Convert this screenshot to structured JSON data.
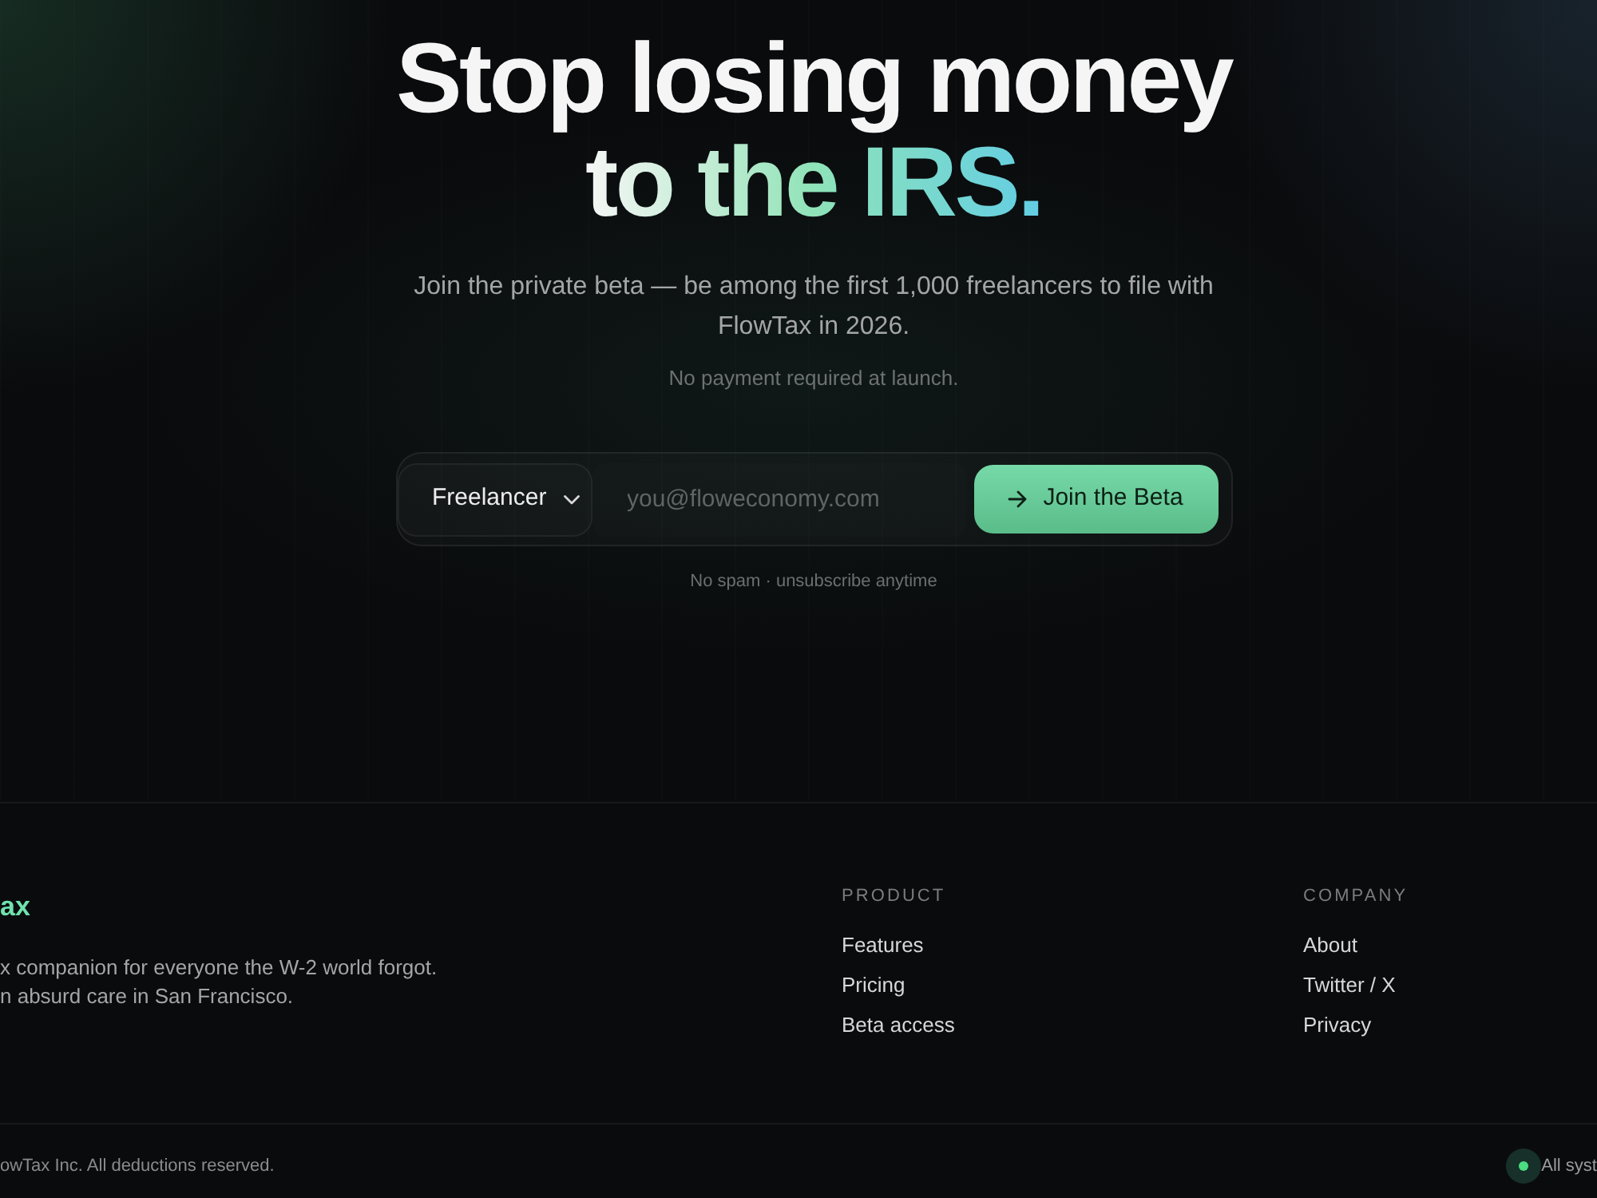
{
  "hero": {
    "headline": {
      "text": "Stop losing money",
      "highlight": "to the IRS."
    },
    "subtitle": "Join the private beta — be among the first 1,000 freelancers to file with FlowTax in 2026.",
    "note": "No payment required at launch."
  },
  "signup_form": {
    "role_select": {
      "value": "Freelancer"
    },
    "email_field": {
      "placeholder": "you@floweconomy.com"
    },
    "submit_button": {
      "label": "Join the Beta"
    },
    "note": "No spam · unsubscribe anytime"
  },
  "footer": {
    "brand": {
      "logo_text": "ax",
      "description_lines": [
        "x companion for everyone the W-2 world forgot.",
        "n absurd care in San Francisco."
      ]
    },
    "columns": [
      {
        "heading": "PRODUCT",
        "links": [
          "Features",
          "Pricing",
          "Beta access"
        ]
      },
      {
        "heading": "COMPANY",
        "links": [
          "About",
          "Twitter / X",
          "Privacy"
        ]
      }
    ],
    "bottom_bar": {
      "copyright": "owTax Inc. All deductions reserved.",
      "status": {
        "label": "All syst"
      }
    }
  }
}
